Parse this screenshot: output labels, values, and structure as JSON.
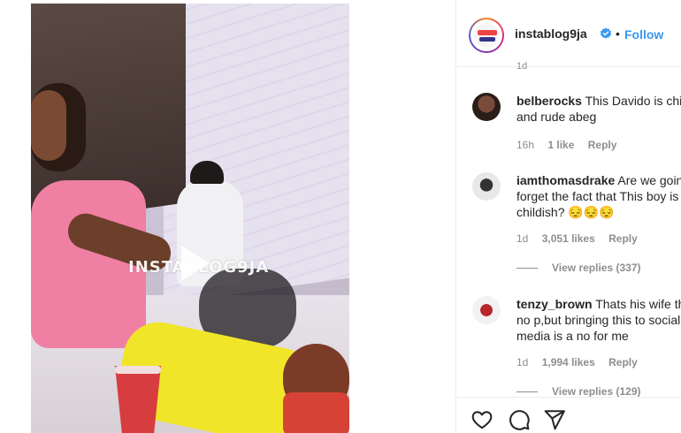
{
  "media": {
    "watermark": "INSTABLOG9JA"
  },
  "header": {
    "username": "instablog9ja",
    "separator": "•",
    "follow_label": "Follow",
    "partial_timestamp": "1d"
  },
  "comments": [
    {
      "username": "belberocks",
      "text_line1": "This Davido is childish",
      "text_line2": "and rude abeg",
      "time": "16h",
      "likes": "1 like",
      "reply_label": "Reply"
    },
    {
      "username": "iamthomasdrake",
      "text_line1": "Are we going to",
      "text_line2": "forget the fact that This boy is",
      "text_line3": "childish? 😔😔😔",
      "time": "1d",
      "likes": "3,051 likes",
      "reply_label": "Reply",
      "view_replies": "View replies (337)"
    },
    {
      "username": "tenzy_brown",
      "text_line1": "Thats his wife there",
      "text_line2": "no p,but bringing this to social",
      "text_line3": "media is a no for me",
      "time": "1d",
      "likes": "1,994 likes",
      "reply_label": "Reply",
      "view_replies": "View replies (129)"
    }
  ],
  "actions": {
    "like_icon": "heart-icon",
    "comment_icon": "comment-icon",
    "share_icon": "share-icon"
  },
  "colors": {
    "link_blue": "#3897f0",
    "muted_gray": "#8e8e8e",
    "text": "#262626"
  }
}
